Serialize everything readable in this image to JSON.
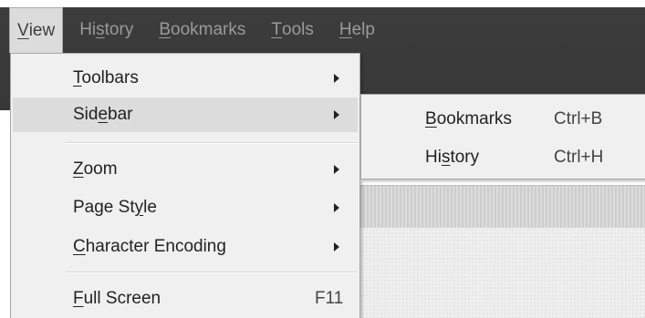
{
  "menubar": {
    "items": [
      {
        "pre": "",
        "key": "V",
        "post": "iew"
      },
      {
        "pre": "Hi",
        "key": "s",
        "post": "tory"
      },
      {
        "pre": "",
        "key": "B",
        "post": "ookmarks"
      },
      {
        "pre": "",
        "key": "T",
        "post": "ools"
      },
      {
        "pre": "",
        "key": "H",
        "post": "elp"
      }
    ]
  },
  "view_menu": {
    "items": [
      {
        "pre": "",
        "key": "T",
        "post": "oolbars",
        "submenu": true
      },
      {
        "pre": "Sid",
        "key": "e",
        "post": "bar",
        "submenu": true
      },
      {
        "pre": "",
        "key": "Z",
        "post": "oom",
        "submenu": true
      },
      {
        "pre": "Page St",
        "key": "y",
        "post": "le",
        "submenu": true
      },
      {
        "pre": "",
        "key": "C",
        "post": "haracter Encoding",
        "submenu": true
      },
      {
        "pre": "",
        "key": "F",
        "post": "ull Screen",
        "shortcut": "F11"
      }
    ]
  },
  "sidebar_submenu": {
    "items": [
      {
        "pre": "",
        "key": "B",
        "post": "ookmarks",
        "shortcut": "Ctrl+B"
      },
      {
        "pre": "Hi",
        "key": "s",
        "post": "tory",
        "shortcut": "Ctrl+H"
      }
    ]
  },
  "colors": {
    "chrome": "#3c3c3c",
    "menu_bg": "#f0f0f0",
    "highlight": "#dcdcdc",
    "text": "#222222",
    "menubar_text_inactive": "#9a9a9a"
  }
}
